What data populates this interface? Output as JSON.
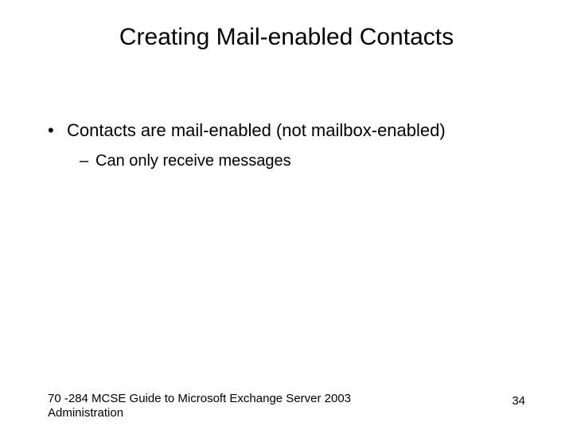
{
  "slide": {
    "title": "Creating Mail-enabled Contacts",
    "bullets": [
      {
        "level": 1,
        "marker": "•",
        "text": "Contacts are mail-enabled (not mailbox-enabled)"
      },
      {
        "level": 2,
        "marker": "–",
        "text": "Can only receive messages"
      }
    ],
    "footer": "70 -284 MCSE Guide to Microsoft Exchange Server 2003 Administration",
    "page_number": "34"
  }
}
